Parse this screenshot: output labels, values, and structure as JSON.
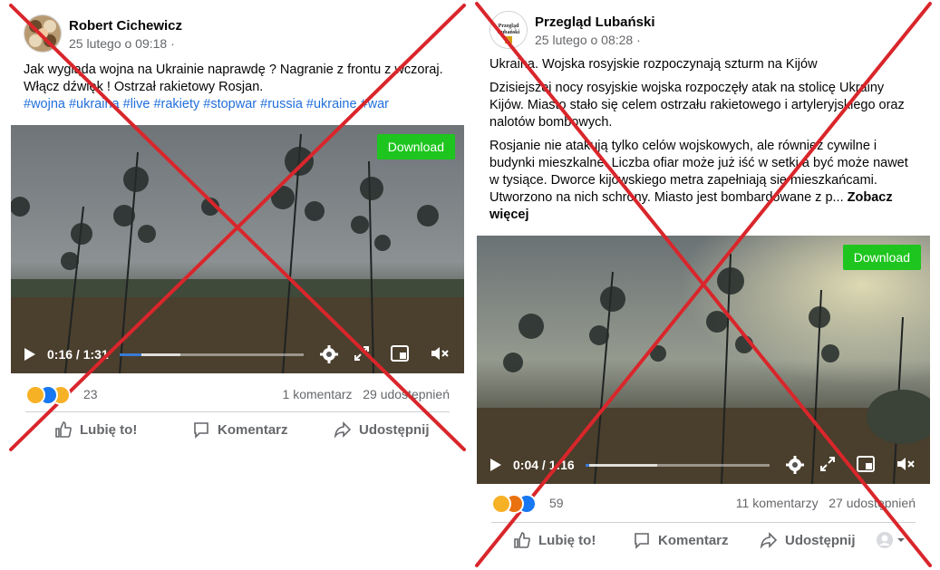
{
  "post1": {
    "author": "Robert Cichewicz",
    "date": "25 lutego o 09:18 ·",
    "text_line1": "Jak wygląda wojna na Ukrainie naprawdę ? Nagranie z frontu z wczoraj.",
    "text_line2": "Włącz dźwięk !  Ostrzał rakietowy Rosjan.",
    "hashtags": "#wojna #ukraina #live #rakiety #stopwar #russia #ukraine #war",
    "download_label": "Download",
    "video_time": "0:16 / 1:31",
    "video_progress": 0.12,
    "video_loaded": 0.33,
    "reaction_count": "23",
    "reactions": [
      "sad",
      "like",
      "care"
    ],
    "comments": "1 komentarz",
    "shares": "29 udostępnień",
    "like_label": "Lubię to!",
    "comment_label": "Komentarz",
    "share_label": "Udostępnij"
  },
  "post2": {
    "author": "Przegląd Lubański",
    "avatar_text": "Przegląd Lubański",
    "date": "25 lutego o 08:28 ·",
    "headline": "Ukraina. Wojska rosyjskie rozpoczynają szturm na Kijów",
    "para1": "Dzisiejszej nocy rosyjskie wojska rozpoczęły atak na stolicę Ukrainy Kijów. Miasto stało się celem ostrzału rakietowego i artyleryjskiego oraz nalotów bombowych.",
    "para2": "Rosjanie nie atakują tylko celów wojskowych, ale również cywilne i budynki mieszkalne. Liczba ofiar może już iść w setki a być może nawet w tysiące. Dworce kijowskiego metra zapełniają się mieszkańcami. Utworzono na nich schrony. Miasto jest bombardowane z p...",
    "see_more": "Zobacz więcej",
    "download_label": "Download",
    "video_time": "0:04 / 1:16",
    "video_progress": 0.02,
    "video_loaded": 0.39,
    "reaction_count": "59",
    "reactions": [
      "sad",
      "angry",
      "like"
    ],
    "comments": "11 komentarzy",
    "shares": "27 udostępnień",
    "like_label": "Lubię to!",
    "comment_label": "Komentarz",
    "share_label": "Udostępnij"
  },
  "colors": {
    "cross": "#d9262b",
    "download": "#1ec51e",
    "hashtag": "#216fdb",
    "progress": "#3a7bd5"
  }
}
